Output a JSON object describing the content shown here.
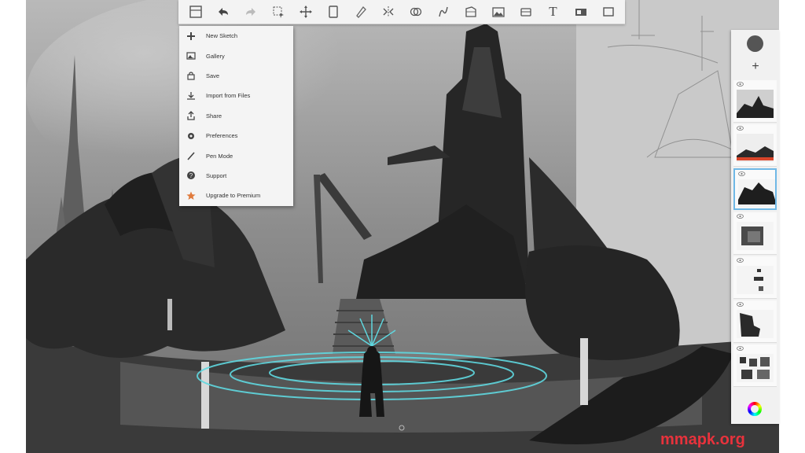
{
  "toolbar": {
    "items": [
      {
        "icon": "menu-icon"
      },
      {
        "icon": "undo-icon"
      },
      {
        "icon": "redo-icon"
      },
      {
        "icon": "select-icon"
      },
      {
        "icon": "transform-icon"
      },
      {
        "icon": "canvas-icon"
      },
      {
        "icon": "brush-icon"
      },
      {
        "icon": "symmetry-icon"
      },
      {
        "icon": "guides-icon"
      },
      {
        "icon": "stroke-icon"
      },
      {
        "icon": "perspective-icon"
      },
      {
        "icon": "import-image-icon"
      },
      {
        "icon": "scan-icon"
      },
      {
        "icon": "text-icon",
        "glyph": "T"
      },
      {
        "icon": "video-icon"
      },
      {
        "icon": "fullscreen-icon"
      }
    ]
  },
  "menu": {
    "items": [
      {
        "label": "New Sketch",
        "icon": "plus-icon"
      },
      {
        "label": "Gallery",
        "icon": "gallery-icon"
      },
      {
        "label": "Save",
        "icon": "save-icon"
      },
      {
        "label": "Import from Files",
        "icon": "import-icon"
      },
      {
        "label": "Share",
        "icon": "share-icon"
      },
      {
        "label": "Preferences",
        "icon": "settings-icon"
      },
      {
        "label": "Pen Mode",
        "icon": "pen-icon"
      },
      {
        "label": "Support",
        "icon": "help-icon"
      },
      {
        "label": "Upgrade to Premium",
        "icon": "star-icon"
      }
    ]
  },
  "layers": {
    "current_color": "#555555",
    "add_label": "+",
    "selected_index": 2,
    "items": [
      {
        "name": "layer-1"
      },
      {
        "name": "layer-2"
      },
      {
        "name": "layer-3"
      },
      {
        "name": "layer-4"
      },
      {
        "name": "layer-5"
      },
      {
        "name": "layer-6"
      },
      {
        "name": "layer-7"
      }
    ]
  },
  "watermark": "mmapk.org",
  "colors": {
    "accent": "#6fb8e6",
    "watermark": "#e8323c",
    "glow": "#5fd8e0"
  }
}
